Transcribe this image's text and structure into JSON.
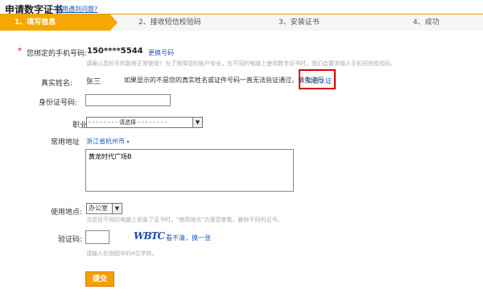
{
  "header": {
    "title": "申请数字证书",
    "help_link": "使用遇到问题?"
  },
  "steps": [
    "1、填写信息",
    "2、接收短信校验码",
    "3、安装证书",
    "4、成功"
  ],
  "phone": {
    "required_mark": "*",
    "label": "您绑定的手机号码:",
    "value": "150****5544",
    "change_link": "更换号码",
    "hint": "请确认您的手机能够正常使用！为了保障您的账户安全，在不同的电脑上使用数字证书时，我们会要求输入手机短信校验码。"
  },
  "real_name": {
    "label": "真实姓名:",
    "value": "张三",
    "note": "如果显示的不是您的真实姓名或证件号码一直无法验证通过，请先进行",
    "verify_link": "实名认证"
  },
  "id_number": {
    "label": "身份证号码:",
    "value": ""
  },
  "occupation": {
    "label": "职业",
    "selected": "- - - - - - - - 请选择 - - - - - - - -"
  },
  "address": {
    "label": "常用地址",
    "region": "浙江省杭州市",
    "value": "黄龙时代广场B"
  },
  "location": {
    "label": "使用地点:",
    "selected": "办公室",
    "hint": "当您在不同的电脑上安装了证书时，\"使用地点\"方便您查看、删除不同的证书。"
  },
  "captcha": {
    "label": "验证码:",
    "value": "",
    "image_text": "WBTC",
    "refresh_link": "看不清，换一张",
    "hint": "请输入右侧图中的4位字符。"
  },
  "submit_label": "提交"
}
